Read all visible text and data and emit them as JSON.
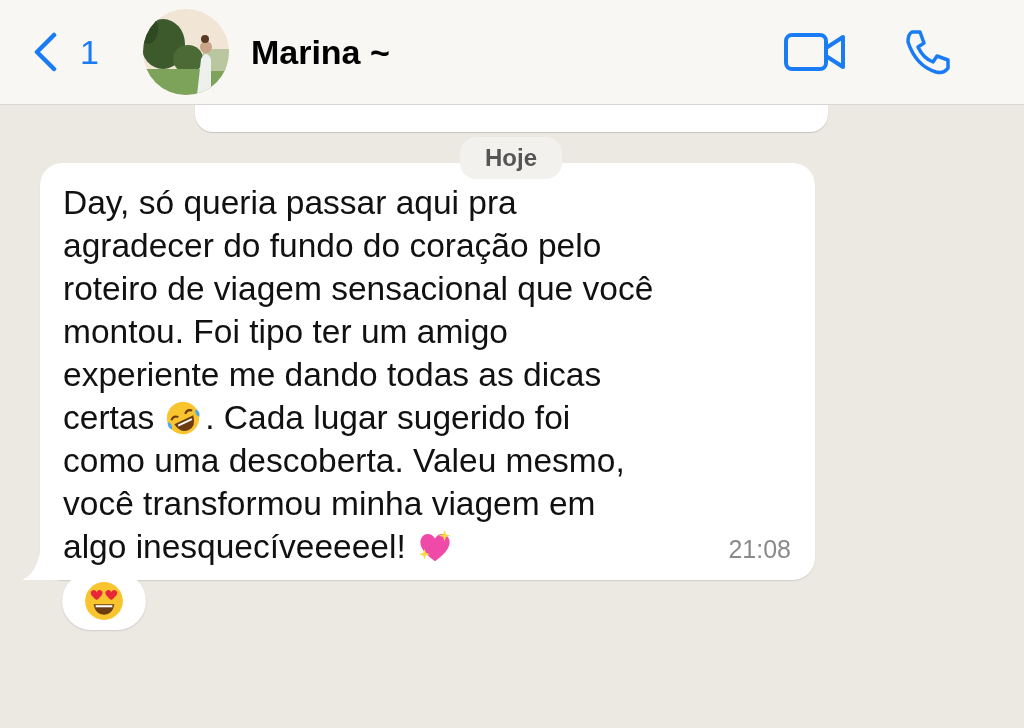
{
  "header": {
    "back_count": "1",
    "contact_name": "Marina ~"
  },
  "date_chip": "Hoje",
  "message": {
    "lines": [
      [
        {
          "kind": "text",
          "text": "Day, só queria passar aqui pra"
        }
      ],
      [
        {
          "kind": "text",
          "text": "agradecer do fundo do coração pelo"
        }
      ],
      [
        {
          "kind": "text",
          "text": "roteiro de viagem sensacional que você"
        }
      ],
      [
        {
          "kind": "text",
          "text": "montou. Foi tipo ter um amigo"
        }
      ],
      [
        {
          "kind": "text",
          "text": "experiente me dando todas as dicas"
        }
      ],
      [
        {
          "kind": "text",
          "text": "certas"
        },
        {
          "kind": "laugh"
        },
        {
          "kind": "text",
          "text": ". Cada lugar sugerido foi"
        }
      ],
      [
        {
          "kind": "text",
          "text": "como uma descoberta. Valeu mesmo,"
        }
      ],
      [
        {
          "kind": "text",
          "text": "você transformou minha viagem em"
        }
      ],
      [
        {
          "kind": "text",
          "text": "algo inesquecíveeeeel!"
        },
        {
          "kind": "heart"
        }
      ]
    ],
    "time": "21:08",
    "reaction": {
      "kind": "hearteyes"
    }
  }
}
